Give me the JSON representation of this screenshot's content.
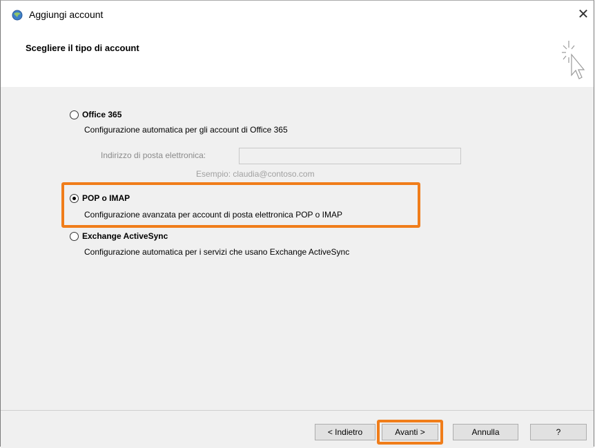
{
  "window": {
    "title": "Aggiungi account",
    "close_glyph": "✕"
  },
  "header": {
    "title": "Scegliere il tipo di account"
  },
  "options": {
    "office365": {
      "label": "Office 365",
      "description": "Configurazione automatica per gli account di Office 365",
      "selected": false,
      "email_label": "Indirizzo di posta elettronica:",
      "email_value": "",
      "example": "Esempio: claudia@contoso.com"
    },
    "pop_imap": {
      "label": "POP o IMAP",
      "description": "Configurazione avanzata per account di posta elettronica POP o IMAP",
      "selected": true
    },
    "activesync": {
      "label": "Exchange ActiveSync",
      "description": "Configurazione automatica per i servizi che usano Exchange ActiveSync",
      "selected": false
    }
  },
  "footer": {
    "back_label": "< Indietro",
    "next_label": "Avanti >",
    "cancel_label": "Annulla",
    "help_label": "?"
  },
  "colors": {
    "highlight": "#f07d1a",
    "content_bg": "#f0f0f0"
  }
}
